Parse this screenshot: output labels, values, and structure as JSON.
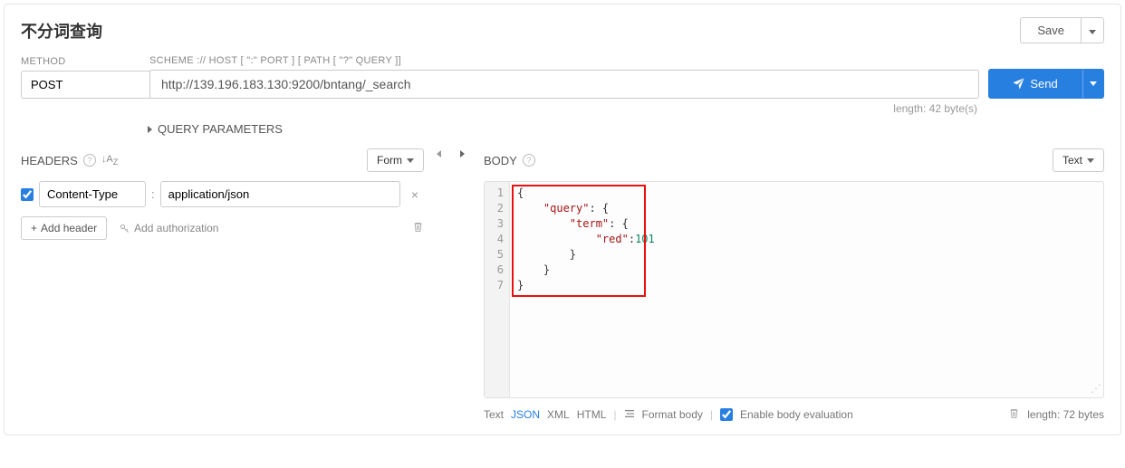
{
  "title": "不分词查询",
  "save_label": "Save",
  "method": {
    "label": "METHOD",
    "value": "POST"
  },
  "url": {
    "label": "SCHEME :// HOST [ \":\" PORT ] [ PATH [ \"?\" QUERY ]]",
    "value": "http://139.196.183.130:9200/bntang/_search",
    "length_text": "length: 42 byte(s)"
  },
  "send_label": "Send",
  "query_params_label": "QUERY PARAMETERS",
  "headers": {
    "title": "HEADERS",
    "form_label": "Form",
    "items": [
      {
        "enabled": true,
        "name": "Content-Type",
        "value": "application/json"
      }
    ],
    "add_header_label": "Add header",
    "add_auth_label": "Add authorization"
  },
  "body": {
    "title": "BODY",
    "text_label": "Text",
    "line_count": 7,
    "code": {
      "l1": "{",
      "l2_key": "\"query\"",
      "l3_key": "\"term\"",
      "l4_key": "\"red\"",
      "l4_val": "101",
      "l5": "        }",
      "l6": "    }",
      "l7": "}"
    },
    "footer": {
      "modes": [
        "Text",
        "JSON",
        "XML",
        "HTML"
      ],
      "active_mode": "JSON",
      "format_label": "Format body",
      "enable_eval_label": "Enable body evaluation",
      "enable_eval_checked": true,
      "length_text": "length: 72 bytes"
    }
  }
}
